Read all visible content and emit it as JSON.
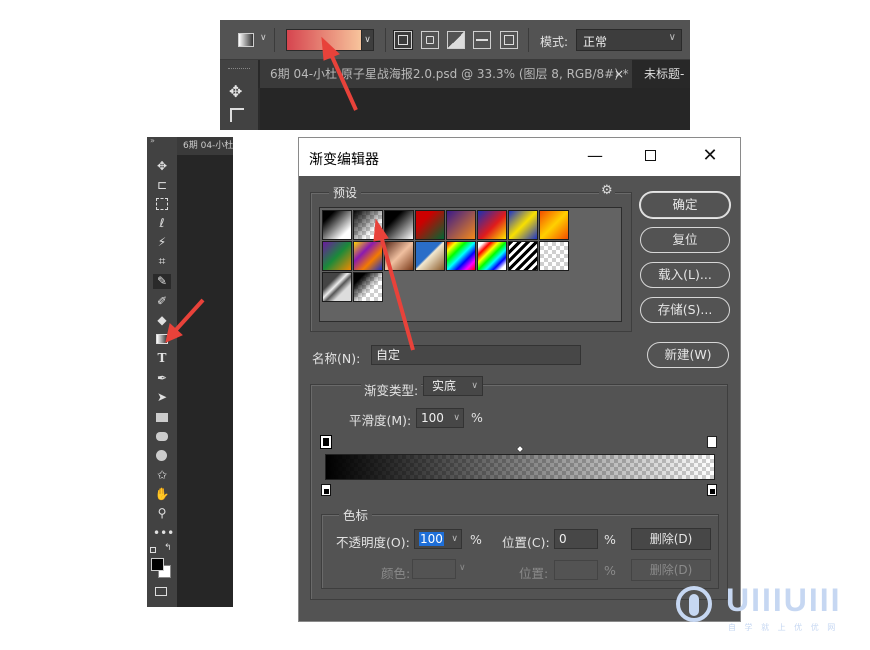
{
  "options_bar": {
    "mode_label": "模式:",
    "mode_value": "正常",
    "gradient_colors": [
      "#d6454f",
      "#f7c49c"
    ]
  },
  "doc_tabs": {
    "tab1": "6期 04-小杜 原子星战海报2.0.psd @ 33.3% (图层 8, RGB/8#) *",
    "tab1_close": "×",
    "tab2": "未标题-"
  },
  "toolbar": {
    "mini_tab": "6期 04-小杜",
    "tools": [
      "move",
      "artboard",
      "marquee",
      "lasso",
      "magic-wand",
      "crop",
      "eyedropper",
      "brush",
      "eraser",
      "gradient",
      "type",
      "pen",
      "path-select",
      "rectangle",
      "rounded-rect",
      "ellipse",
      "custom-shape",
      "hand",
      "zoom",
      "more"
    ]
  },
  "dialog": {
    "title": "渐变编辑器",
    "presets_label": "预设",
    "buttons": {
      "ok": "确定",
      "reset": "复位",
      "load": "载入(L)...",
      "save": "存储(S)...",
      "new": "新建(W)"
    },
    "name_label": "名称(N):",
    "name_value": "自定",
    "gradient_type_label": "渐变类型:",
    "gradient_type_value": "实底",
    "smoothness_label": "平滑度(M):",
    "smoothness_value": "100",
    "percent": "%",
    "stops_group_label": "色标",
    "opacity_label": "不透明度(O):",
    "opacity_value": "100",
    "location_label": "位置(C):",
    "location_value": "0",
    "delete_label": "删除(D)",
    "color_label": "颜色:",
    "location2_label": "位置:",
    "delete2_label": "删除(D)"
  },
  "watermark": {
    "brand": "UIIIUIII",
    "sub": "自 学 就 上 优 优 网"
  },
  "colors": {
    "ps_panel": "#535353",
    "ps_dark": "#262626",
    "arrow": "#e8423a",
    "selected_field": "#1e6fd9"
  }
}
